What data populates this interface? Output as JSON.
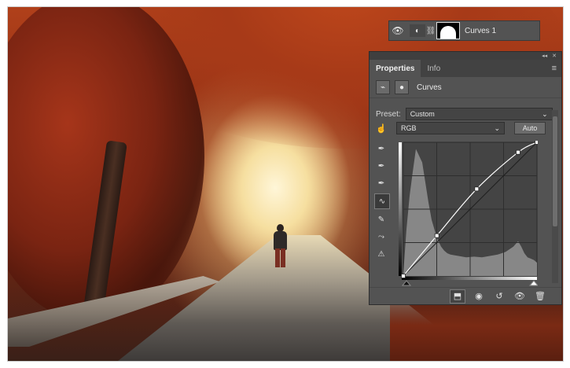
{
  "layer": {
    "name": "Curves 1",
    "icons": [
      "eye-icon",
      "adjustment-icon",
      "link-icon",
      "mask-thumbnail"
    ]
  },
  "panel": {
    "tabs": [
      {
        "label": "Properties",
        "active": true
      },
      {
        "label": "Info",
        "active": false
      }
    ],
    "title": "Curves",
    "preset_label": "Preset:",
    "preset_value": "Custom",
    "channel_value": "RGB",
    "auto_label": "Auto",
    "tools": [
      "hand-on-image-icon",
      "eyedropper-black-icon",
      "eyedropper-gray-icon",
      "eyedropper-white-icon",
      "curve-point-tool-icon",
      "pencil-icon",
      "smooth-icon",
      "clipping-warning-icon"
    ],
    "bottom_buttons": [
      "clip-to-layer-icon",
      "view-previous-icon",
      "reset-icon",
      "visibility-icon",
      "trash-icon"
    ]
  },
  "curve": {
    "points": [
      [
        0,
        0
      ],
      [
        64,
        77
      ],
      [
        140,
        166
      ],
      [
        219,
        236
      ],
      [
        255,
        255
      ]
    ]
  },
  "colors": {
    "panel_bg": "#535353",
    "graph_bg": "#444444",
    "histogram": "#8b8b8b",
    "curve": "#ffffff"
  }
}
